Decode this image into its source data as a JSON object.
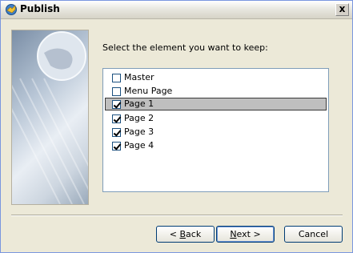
{
  "window": {
    "title": "Publish",
    "close_label": "x"
  },
  "prompt": "Select the element you want to keep:",
  "items": [
    {
      "label": "Master",
      "checked": false,
      "selected": false
    },
    {
      "label": "Menu Page",
      "checked": false,
      "selected": false
    },
    {
      "label": "Page 1",
      "checked": true,
      "selected": true
    },
    {
      "label": "Page 2",
      "checked": true,
      "selected": false
    },
    {
      "label": "Page 3",
      "checked": true,
      "selected": false
    },
    {
      "label": "Page 4",
      "checked": true,
      "selected": false
    }
  ],
  "buttons": {
    "back_arrow": "< ",
    "back_mnemonic": "B",
    "back_rest": "ack",
    "next_mnemonic": "N",
    "next_rest": "ext >",
    "cancel": "Cancel"
  }
}
